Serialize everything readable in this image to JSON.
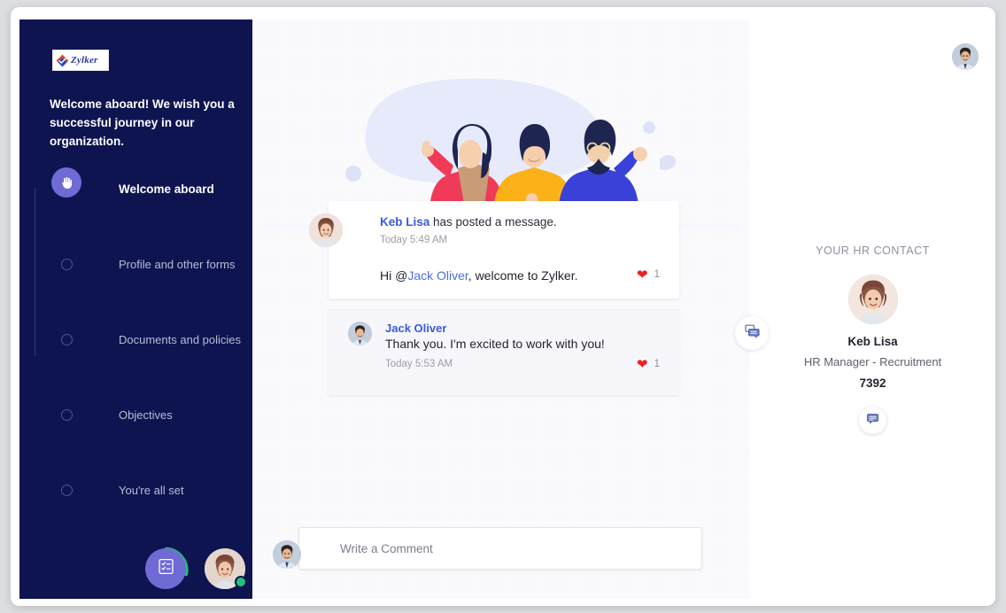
{
  "brand": {
    "logo_text": "Zylker",
    "accent_purple": "#6f6ad4",
    "sidebar_navy": "#0d1450",
    "link_blue": "#3a5bd9",
    "heart_red": "#f1201f",
    "online_green": "#21c17a"
  },
  "sidebar": {
    "welcome_message": "Welcome aboard! We wish you a successful journey in our organization.",
    "steps": [
      {
        "label": "Welcome aboard",
        "state": "active",
        "icon": "waving-hand-icon"
      },
      {
        "label": "Profile and other forms",
        "state": "pending",
        "icon": "step-dot-icon"
      },
      {
        "label": "Documents and policies",
        "state": "pending",
        "icon": "step-dot-icon"
      },
      {
        "label": "Objectives",
        "state": "pending",
        "icon": "step-dot-icon"
      },
      {
        "label": "You're all set",
        "state": "pending",
        "icon": "step-dot-icon"
      }
    ],
    "checklist_fab_icon": "checklist-icon",
    "progress_arc_color": "#21c17a",
    "avatar_status": "online"
  },
  "feed": {
    "illustration": "three-people-celebrating-illustration",
    "post": {
      "author": "Keb Lisa",
      "header_suffix": " has posted a message.",
      "timestamp": "Today 5:49 AM",
      "text_before_mention": "Hi @",
      "mention": "Jack Oliver",
      "text_after_mention": ", welcome to Zylker.",
      "like_icon": "heart-icon",
      "like_count": "1"
    },
    "reply": {
      "author": "Jack Oliver",
      "text": "Thank you. I'm excited to work with you!",
      "timestamp": "Today 5:53 AM",
      "like_icon": "heart-icon",
      "like_count": "1"
    },
    "comment": {
      "placeholder": "Write a Comment",
      "value": ""
    },
    "chat_fab_icon": "chat-bubbles-icon"
  },
  "hr_panel": {
    "heading": "YOUR HR CONTACT",
    "name": "Keb Lisa",
    "role": "HR Manager - Recruitment",
    "extension": "7392",
    "chat_button_icon": "chat-bubble-icon",
    "top_avatar_icon": "user-avatar"
  }
}
